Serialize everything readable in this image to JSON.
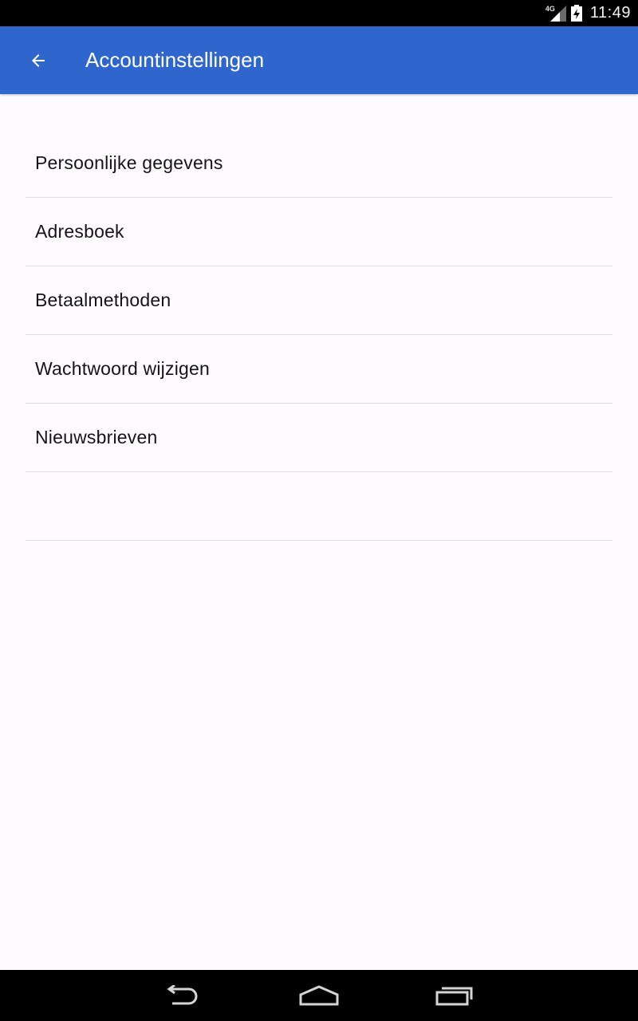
{
  "status_bar": {
    "network": "4G",
    "time": "11:49",
    "icons": [
      "signal-icon",
      "battery-icon"
    ]
  },
  "app_bar": {
    "back_icon": "arrow-back-icon",
    "title": "Accountinstellingen",
    "background_color": "#2f66ce"
  },
  "settings": {
    "items": [
      {
        "label": "Persoonlijke gegevens"
      },
      {
        "label": "Adresboek"
      },
      {
        "label": "Betaalmethoden"
      },
      {
        "label": "Wachtwoord wijzigen"
      },
      {
        "label": "Nieuwsbrieven"
      },
      {
        "label": ""
      }
    ]
  },
  "nav_bar": {
    "icons": [
      "back-nav-icon",
      "home-nav-icon",
      "recents-nav-icon"
    ]
  }
}
